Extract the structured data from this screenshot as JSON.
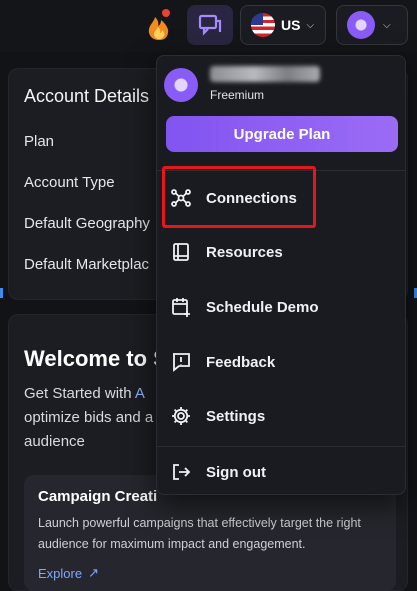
{
  "topbar": {
    "locale": "US",
    "icons": [
      "fire-icon",
      "chat-icon",
      "us-flag-icon",
      "chevron-down-icon",
      "avatar"
    ]
  },
  "account_card": {
    "title": "Account Details",
    "rows": [
      "Plan",
      "Account Type",
      "Default Geography",
      "Default Marketplac"
    ]
  },
  "welcome_card": {
    "title": "Welcome to S",
    "para_prefix": "Get Started with ",
    "para_accent": "A",
    "para_line2": "optimize bids and a",
    "para_line3": "audience",
    "campaign": {
      "title": "Campaign Creati",
      "description": "Launch powerful campaigns that effectively target the right audience for maximum impact and engagement.",
      "link": "Explore"
    }
  },
  "menu": {
    "plan": "Freemium",
    "upgrade_label": "Upgrade Plan",
    "items": [
      {
        "label": "Connections",
        "icon": "connections-icon"
      },
      {
        "label": "Resources",
        "icon": "book-icon"
      },
      {
        "label": "Schedule Demo",
        "icon": "calendar-plus-icon"
      },
      {
        "label": "Feedback",
        "icon": "feedback-icon"
      },
      {
        "label": "Settings",
        "icon": "gear-icon"
      },
      {
        "label": "Sign out",
        "icon": "sign-out-icon"
      }
    ]
  },
  "colors": {
    "accent": "#8254f1",
    "highlight": "#e5161c",
    "link": "#7fa7ff"
  }
}
